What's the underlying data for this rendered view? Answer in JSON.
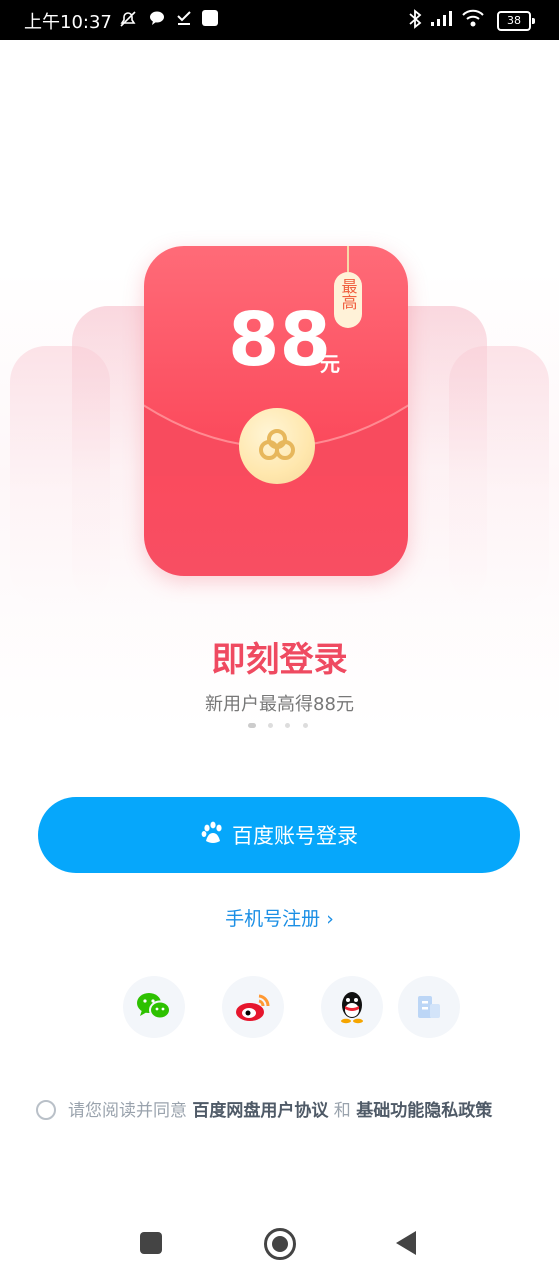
{
  "status_bar": {
    "time": "上午10:37",
    "battery": "38",
    "icons": [
      "mute-icon",
      "chat-bubble-icon",
      "download-check-icon",
      "app-square-icon",
      "bluetooth-icon",
      "signal-icon",
      "wifi-icon",
      "battery-icon"
    ]
  },
  "promo": {
    "amount": "88",
    "unit": "元",
    "tag": "最高",
    "title": "即刻登录",
    "subtitle": "新用户最高得88元",
    "pages": 4,
    "active_page": 0
  },
  "login": {
    "primary_label": "百度账号登录",
    "register_label": "手机号注册 ›"
  },
  "social": [
    {
      "name": "wechat",
      "icon": "wechat-icon"
    },
    {
      "name": "weibo",
      "icon": "weibo-icon"
    },
    {
      "name": "qq",
      "icon": "qq-icon"
    },
    {
      "name": "enterprise",
      "icon": "building-icon"
    }
  ],
  "agreement": {
    "prefix": "请您阅读并同意 ",
    "link1": "百度网盘用户协议",
    "and": " 和 ",
    "link2": "基础功能隐私政策"
  },
  "colors": {
    "primary": "#06a7fb",
    "envelope_red": "#fb4a5c",
    "title_red": "#ef4a61",
    "link_blue": "#1b8fe5"
  }
}
